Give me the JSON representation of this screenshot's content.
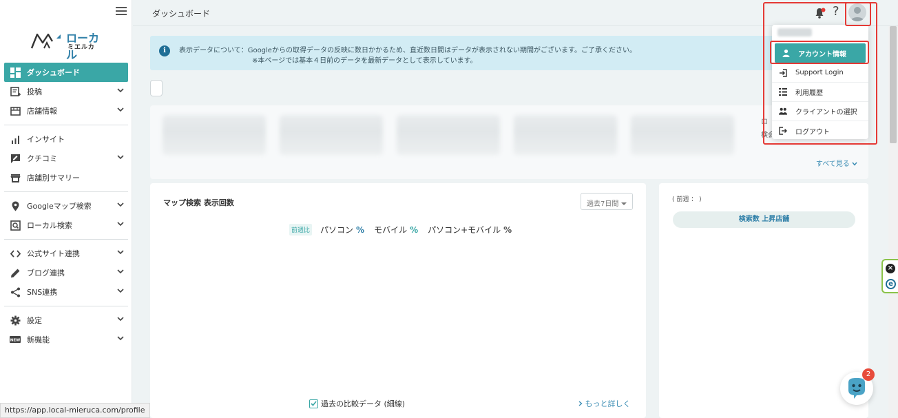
{
  "sidebar": {
    "logo": {
      "text_top": "ローカル",
      "text_bottom": "ミエルカ"
    },
    "items": [
      {
        "label": "ダッシュボード",
        "icon": "dashboard-icon",
        "active": true,
        "chevron": false
      },
      {
        "label": "投稿",
        "icon": "post-icon",
        "chevron": true
      },
      {
        "label": "店舗情報",
        "icon": "store-icon",
        "chevron": true
      },
      {
        "label": "インサイト",
        "icon": "bar-chart-icon",
        "chevron": false
      },
      {
        "label": "クチコミ",
        "icon": "review-icon",
        "chevron": true
      },
      {
        "label": "店舗別サマリー",
        "icon": "storefront-icon",
        "chevron": false
      },
      {
        "label": "Googleマップ検索",
        "icon": "map-pin-icon",
        "chevron": true
      },
      {
        "label": "ローカル検索",
        "icon": "local-search-icon",
        "chevron": true
      },
      {
        "label": "公式サイト連携",
        "icon": "code-icon",
        "chevron": true
      },
      {
        "label": "ブログ連携",
        "icon": "pencil-icon",
        "chevron": true
      },
      {
        "label": "SNS連携",
        "icon": "share-icon",
        "chevron": true
      },
      {
        "label": "設定",
        "icon": "gear-icon",
        "chevron": true
      },
      {
        "label": "新機能",
        "icon": "new-badge-icon",
        "chevron": true
      }
    ]
  },
  "header": {
    "title": "ダッシュボード",
    "help": "?"
  },
  "banner": {
    "line1": "表示データについて：Googleからの取得データの反映に数日かかるため、直近数日間はデータが表示されない期間がございます。ご了承ください。",
    "line2": "※本ページでは基本４日前のデータを最新データとして表示しています。"
  },
  "summary": {
    "see_all": "すべて見る",
    "fragment1": "ロ",
    "fragment2": "検会"
  },
  "map_card": {
    "title": "マップ検索 表示回数",
    "period": "過去7日間",
    "legend_tag": "前週比",
    "legend": [
      {
        "label": "パソコン",
        "value": "%"
      },
      {
        "label": "モバイル",
        "value": "%"
      },
      {
        "label": "パソコン+モバイル",
        "value": "%"
      }
    ],
    "compare_label": "過去の比較データ (細線)",
    "more_label": "もっと詳しく"
  },
  "rank_card": {
    "prev_week": "( 前週 ： )",
    "pill": "検索数 上昇店舗"
  },
  "dropdown": {
    "items": [
      {
        "label": "アカウント情報",
        "icon": "person-icon",
        "active": true
      },
      {
        "label": "Support Login",
        "icon": "login-icon"
      },
      {
        "label": "利用履歴",
        "icon": "history-list-icon"
      },
      {
        "label": "クライアントの選択",
        "icon": "people-icon"
      },
      {
        "label": "ログアウト",
        "icon": "logout-icon"
      }
    ]
  },
  "chat": {
    "badge": "2"
  },
  "status_url": "https://app.local-mieruca.com/profile",
  "colors": {
    "accent": "#3aa7a6",
    "link": "#3a8cb3",
    "highlight": "#e53935",
    "banner": "#d2ecf4"
  }
}
